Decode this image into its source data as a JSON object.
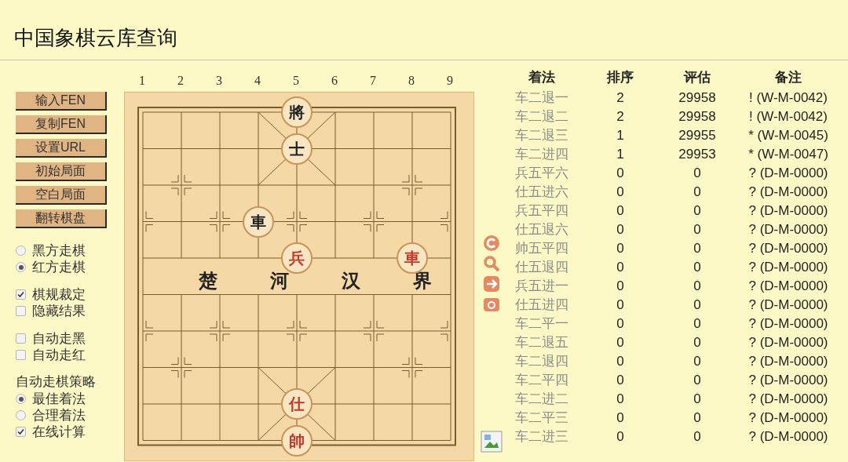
{
  "title": "中国象棋云库查询",
  "buttons": [
    "输入FEN",
    "复制FEN",
    "设置URL",
    "初始局面",
    "空白局面",
    "翻转棋盘"
  ],
  "turn": [
    {
      "label": "黑方走棋",
      "selected": false
    },
    {
      "label": "红方走棋",
      "selected": true
    }
  ],
  "rules": [
    {
      "label": "棋规裁定",
      "checked": true
    },
    {
      "label": "隐藏结果",
      "checked": false
    }
  ],
  "auto": [
    {
      "label": "自动走黑",
      "checked": false
    },
    {
      "label": "自动走红",
      "checked": false
    }
  ],
  "strategy": {
    "label": "自动走棋策略",
    "options": [
      {
        "label": "最佳着法",
        "selected": true
      },
      {
        "label": "合理着法",
        "selected": false
      }
    ],
    "online": {
      "label": "在线计算",
      "checked": true
    }
  },
  "board": {
    "files": [
      "1",
      "2",
      "3",
      "4",
      "5",
      "6",
      "7",
      "8",
      "9"
    ],
    "river": [
      "楚",
      "河",
      "汉",
      "界"
    ],
    "ranks": [
      [
        {
          "kind": "empty"
        },
        {
          "kind": "empty"
        },
        {
          "kind": "empty"
        },
        {
          "kind": "empty"
        },
        {
          "text": "將",
          "kind": "black"
        },
        {
          "kind": "empty"
        },
        {
          "kind": "empty"
        },
        {
          "kind": "empty"
        },
        {
          "kind": "empty"
        }
      ],
      [
        {
          "kind": "empty"
        },
        {
          "kind": "empty"
        },
        {
          "kind": "empty"
        },
        {
          "kind": "empty"
        },
        {
          "text": "士",
          "kind": "black"
        },
        {
          "kind": "empty"
        },
        {
          "kind": "empty"
        },
        {
          "kind": "empty"
        },
        {
          "kind": "empty"
        }
      ],
      [
        {
          "kind": "empty"
        },
        {
          "kind": "empty"
        },
        {
          "kind": "empty"
        },
        {
          "kind": "empty"
        },
        {
          "kind": "empty"
        },
        {
          "kind": "empty"
        },
        {
          "kind": "empty"
        },
        {
          "kind": "empty"
        },
        {
          "kind": "empty"
        }
      ],
      [
        {
          "kind": "empty"
        },
        {
          "kind": "empty"
        },
        {
          "kind": "empty"
        },
        {
          "text": "車",
          "kind": "black"
        },
        {
          "kind": "empty"
        },
        {
          "kind": "empty"
        },
        {
          "kind": "empty"
        },
        {
          "kind": "empty"
        },
        {
          "kind": "empty"
        }
      ],
      [
        {
          "kind": "empty"
        },
        {
          "kind": "empty"
        },
        {
          "kind": "empty"
        },
        {
          "kind": "empty"
        },
        {
          "text": "兵",
          "kind": "red"
        },
        {
          "kind": "empty"
        },
        {
          "kind": "empty"
        },
        {
          "text": "車",
          "kind": "red"
        },
        {
          "kind": "empty"
        }
      ],
      [
        {
          "kind": "empty"
        },
        {
          "kind": "empty"
        },
        {
          "kind": "empty"
        },
        {
          "kind": "empty"
        },
        {
          "kind": "empty"
        },
        {
          "kind": "empty"
        },
        {
          "kind": "empty"
        },
        {
          "kind": "empty"
        },
        {
          "kind": "empty"
        }
      ],
      [
        {
          "kind": "empty"
        },
        {
          "kind": "empty"
        },
        {
          "kind": "empty"
        },
        {
          "kind": "empty"
        },
        {
          "kind": "empty"
        },
        {
          "kind": "empty"
        },
        {
          "kind": "empty"
        },
        {
          "kind": "empty"
        },
        {
          "kind": "empty"
        }
      ],
      [
        {
          "kind": "empty"
        },
        {
          "kind": "empty"
        },
        {
          "kind": "empty"
        },
        {
          "kind": "empty"
        },
        {
          "kind": "empty"
        },
        {
          "kind": "empty"
        },
        {
          "kind": "empty"
        },
        {
          "kind": "empty"
        },
        {
          "kind": "empty"
        }
      ],
      [
        {
          "kind": "empty"
        },
        {
          "kind": "empty"
        },
        {
          "kind": "empty"
        },
        {
          "kind": "empty"
        },
        {
          "text": "仕",
          "kind": "red"
        },
        {
          "kind": "empty"
        },
        {
          "kind": "empty"
        },
        {
          "kind": "empty"
        },
        {
          "kind": "empty"
        }
      ],
      [
        {
          "kind": "empty"
        },
        {
          "kind": "empty"
        },
        {
          "kind": "empty"
        },
        {
          "kind": "empty"
        },
        {
          "text": "帥",
          "kind": "red"
        },
        {
          "kind": "empty"
        },
        {
          "kind": "empty"
        },
        {
          "kind": "empty"
        },
        {
          "kind": "empty"
        }
      ]
    ]
  },
  "table": {
    "columns": [
      "着法",
      "排序",
      "评估",
      "备注"
    ],
    "rows": [
      [
        "车二退一",
        "2",
        "29958",
        "! (W-M-0042)"
      ],
      [
        "车二退二",
        "2",
        "29958",
        "! (W-M-0042)"
      ],
      [
        "车二退三",
        "1",
        "29955",
        "* (W-M-0045)"
      ],
      [
        "车二进四",
        "1",
        "29953",
        "* (W-M-0047)"
      ],
      [
        "兵五平六",
        "0",
        "0",
        "? (D-M-0000)"
      ],
      [
        "仕五进六",
        "0",
        "0",
        "? (D-M-0000)"
      ],
      [
        "兵五平四",
        "0",
        "0",
        "? (D-M-0000)"
      ],
      [
        "仕五退六",
        "0",
        "0",
        "? (D-M-0000)"
      ],
      [
        "帅五平四",
        "0",
        "0",
        "? (D-M-0000)"
      ],
      [
        "仕五退四",
        "0",
        "0",
        "? (D-M-0000)"
      ],
      [
        "兵五进一",
        "0",
        "0",
        "? (D-M-0000)"
      ],
      [
        "仕五进四",
        "0",
        "0",
        "? (D-M-0000)"
      ],
      [
        "车二平一",
        "0",
        "0",
        "? (D-M-0000)"
      ],
      [
        "车二退五",
        "0",
        "0",
        "? (D-M-0000)"
      ],
      [
        "车二退四",
        "0",
        "0",
        "? (D-M-0000)"
      ],
      [
        "车二平四",
        "0",
        "0",
        "? (D-M-0000)"
      ],
      [
        "车二进二",
        "0",
        "0",
        "? (D-M-0000)"
      ],
      [
        "车二平三",
        "0",
        "0",
        "? (D-M-0000)"
      ],
      [
        "车二进三",
        "0",
        "0",
        "? (D-M-0000)"
      ]
    ]
  }
}
